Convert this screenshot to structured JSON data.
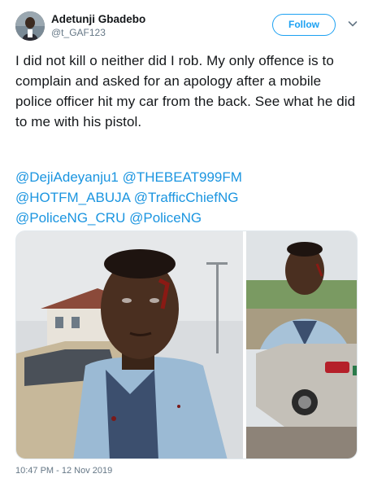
{
  "user": {
    "display_name": "Adetunji Gbadebo",
    "handle": "@t_GAF123"
  },
  "actions": {
    "follow_label": "Follow",
    "caret_icon": "chevron-down-icon"
  },
  "tweet": {
    "text": "I did not kill o neither did I rob. My only offence is to complain and asked for an apology after a mobile police officer hit my car from the back. See what he did to me with his pistol.",
    "mentions": [
      "@DejiAdeyanju1",
      "@THEBEAT999FM",
      "@HOTFM_ABUJA",
      "@TrafficChiefNG",
      "@PoliceNG_CRU",
      "@PoliceNG"
    ],
    "timestamp": "10:47 PM - 12 Nov 2019"
  },
  "colors": {
    "link": "#1b95e0",
    "follow": "#1da1f2",
    "secondary_text": "#657786"
  },
  "media": {
    "photo_count": 2
  }
}
